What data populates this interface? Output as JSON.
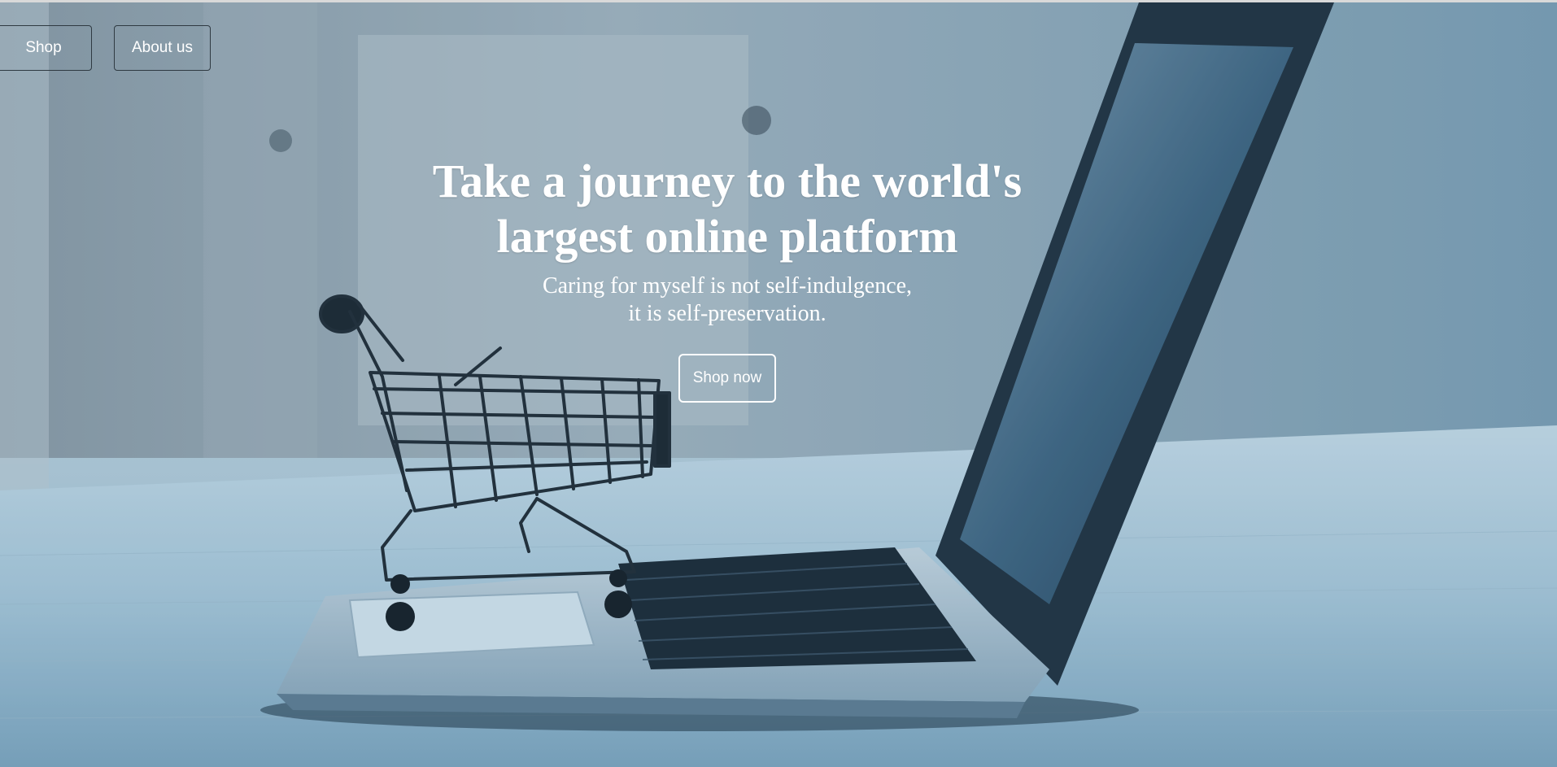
{
  "nav": {
    "shop_label": "Shop",
    "about_label": "About us"
  },
  "hero": {
    "title_line1": "Take a journey to the world's",
    "title_line2": "largest online platform",
    "subtitle_line1": "Caring for myself is not self-indulgence,",
    "subtitle_line2": "it is self-preservation.",
    "cta_label": "Shop now",
    "image_subject": "shopping cart on laptop keyboard",
    "tint_color": "#5f8aa6"
  }
}
